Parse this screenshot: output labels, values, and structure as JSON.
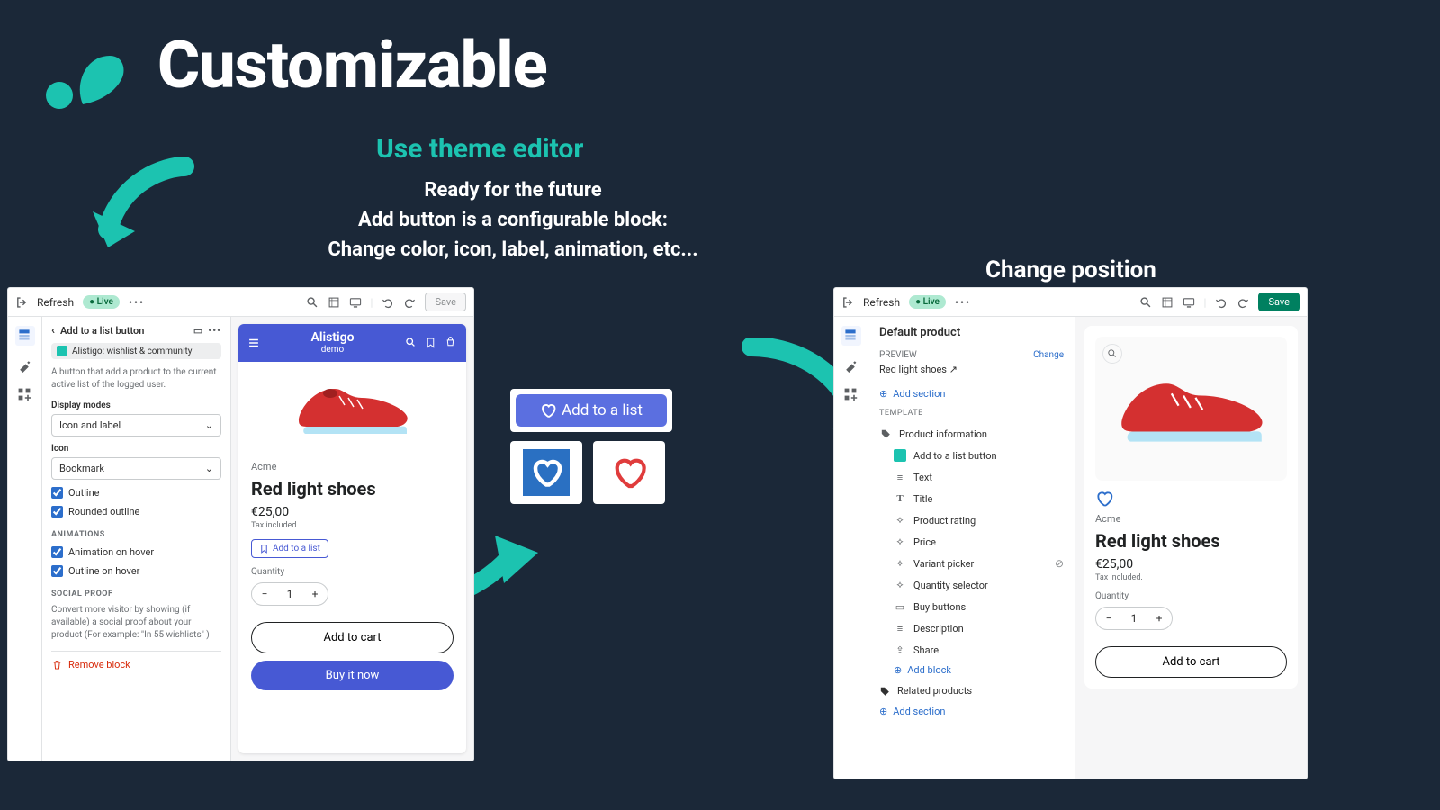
{
  "hero": {
    "title": "Customizable",
    "sub1": "Use theme editor",
    "sub2": "Ready for the future\nAdd button is a configurable block:\nChange color, icon, label, animation, etc...",
    "right_title": "Change position"
  },
  "topbar": {
    "refresh": "Refresh",
    "live": "Live",
    "save": "Save"
  },
  "left_panel": {
    "block_title": "Add to a list button",
    "app_name": "Alistigo: wishlist & community",
    "description": "A button that add a product to the current active list of the logged user.",
    "display_modes_label": "Display modes",
    "display_modes_value": "Icon and label",
    "icon_label": "Icon",
    "icon_value": "Bookmark",
    "outline": "Outline",
    "rounded": "Rounded outline",
    "animations_section": "ANIMATIONS",
    "anim_hover": "Animation on hover",
    "outline_hover": "Outline on hover",
    "social_section": "SOCIAL PROOF",
    "social_desc": "Convert more visitor by showing (if available) a social proof about your product (For example: \"In 55 wishlists\" )",
    "remove": "Remove block"
  },
  "phone": {
    "shop_name": "Alistigo",
    "shop_sub": "demo",
    "brand": "Acme",
    "product_title": "Red light shoes",
    "price": "€25,00",
    "tax": "Tax included.",
    "atl": "Add to a list",
    "qty_label": "Quantity",
    "qty_value": "1",
    "cart": "Add to cart",
    "buy": "Buy it now"
  },
  "sample_button_label": "Add to a list",
  "right_panel": {
    "header": "Default product",
    "preview_label": "PREVIEW",
    "change": "Change",
    "preview_name": "Red light shoes",
    "add_section": "Add section",
    "template_label": "TEMPLATE",
    "product_info": "Product information",
    "blocks": {
      "atl": "Add to a list button",
      "text": "Text",
      "title": "Title",
      "rating": "Product rating",
      "price": "Price",
      "variant": "Variant picker",
      "qty": "Quantity selector",
      "buy": "Buy buttons",
      "desc": "Description",
      "share": "Share"
    },
    "add_block": "Add block",
    "related": "Related products",
    "add_section2": "Add section"
  },
  "p2_product": {
    "brand": "Acme",
    "title": "Red light shoes",
    "price": "€25,00",
    "tax": "Tax included.",
    "qty_label": "Quantity",
    "qty_value": "1",
    "cart": "Add to cart"
  }
}
